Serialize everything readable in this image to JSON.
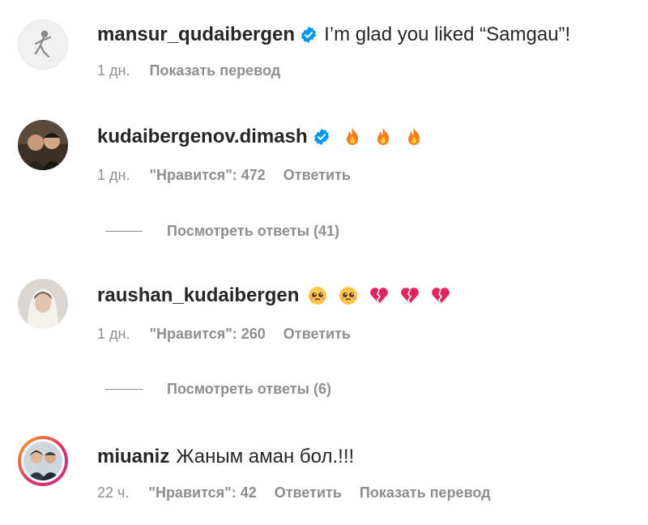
{
  "comments": [
    {
      "username": "mansur_qudaibergen",
      "verified": true,
      "text": "I’m glad you liked “Samgau”!",
      "emojis": [],
      "time": "1 дн.",
      "likes": "",
      "reply_label": "",
      "translate_label": "Показать перевод",
      "avatar_icon": "avatar-dancer-icon"
    },
    {
      "username": "kudaibergenov.dimash",
      "verified": true,
      "text": "",
      "emojis": [
        "fire-emoji",
        "fire-emoji",
        "fire-emoji"
      ],
      "time": "1 дн.",
      "likes": "\"Нравится\": 472",
      "reply_label": "Ответить",
      "translate_label": "",
      "view_replies": "Посмотреть ответы (41)",
      "avatar_icon": "avatar-photo-icon"
    },
    {
      "username": "raushan_kudaibergen",
      "verified": false,
      "text": "",
      "emojis": [
        "pleading-face-emoji",
        "pleading-face-emoji",
        "broken-heart-emoji",
        "broken-heart-emoji",
        "broken-heart-emoji"
      ],
      "time": "1 дн.",
      "likes": "\"Нравится\": 260",
      "reply_label": "Ответить",
      "translate_label": "",
      "view_replies": "Посмотреть ответы (6)",
      "avatar_icon": "avatar-photo-icon"
    },
    {
      "username": "miuaniz",
      "verified": false,
      "text": "Жаным аман бол.!!!",
      "emojis": [],
      "time": "22 ч.",
      "likes": "\"Нравится\": 42",
      "reply_label": "Ответить",
      "translate_label": "Показать перевод",
      "avatar_icon": "avatar-story-ring-icon"
    }
  ],
  "colors": {
    "text": "#262626",
    "secondary": "#8e8e8e",
    "verified": "#0095f6"
  }
}
